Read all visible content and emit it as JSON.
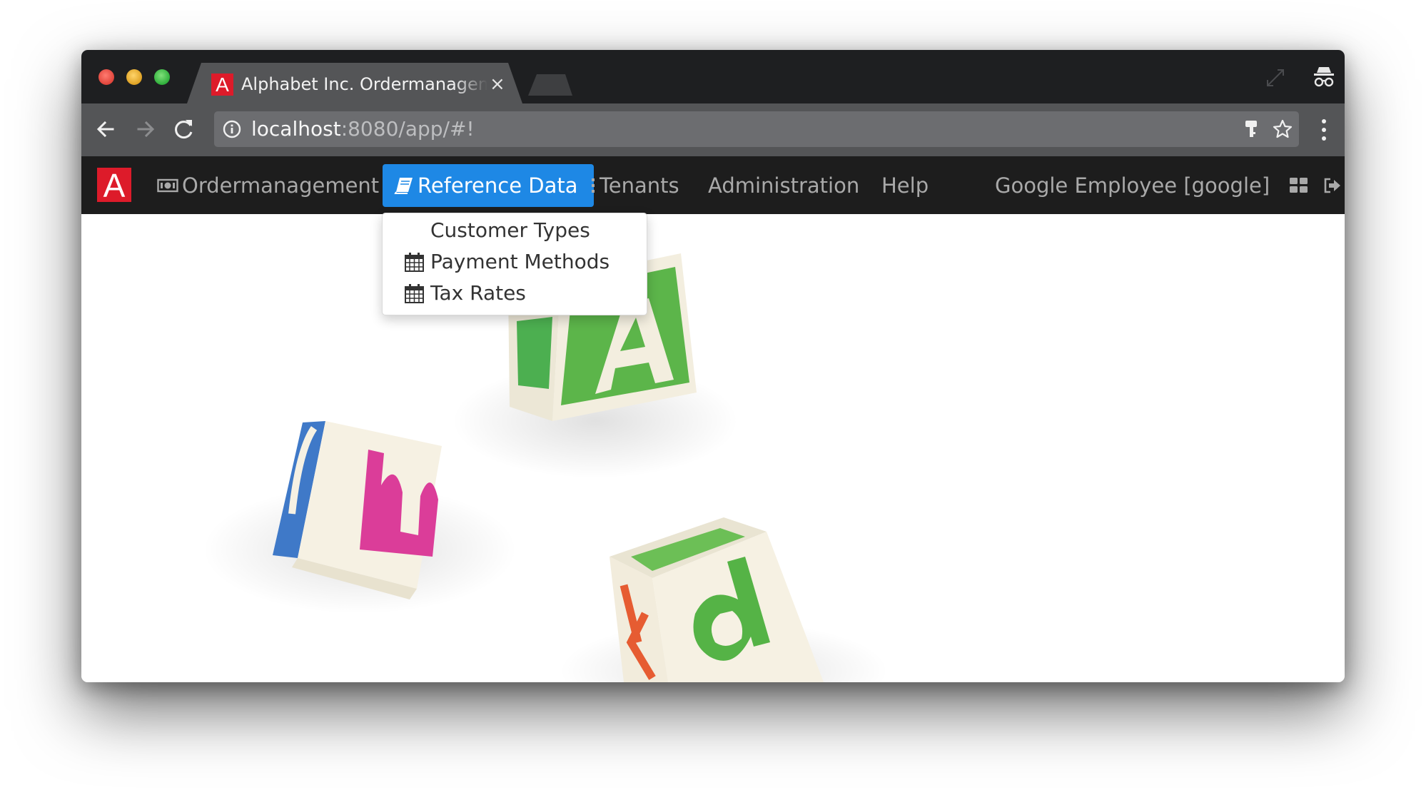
{
  "browser": {
    "tab_title": "Alphabet Inc. Ordermanagement",
    "tab_close_icon": "×",
    "url_host": "localhost",
    "url_rest": ":8080/app/#!",
    "icons": [
      "back-arrow-icon",
      "forward-arrow-icon",
      "reload-icon",
      "info-icon",
      "key-icon",
      "star-icon",
      "menu-icon",
      "incognito-icon",
      "sync-icon"
    ]
  },
  "app": {
    "brand_letter": "A",
    "brand_color": "#dd1b2a",
    "accent_color": "#1e88e5",
    "nav": {
      "ordermanagement": "Ordermanagement",
      "reference_data": "Reference Data",
      "tenants": "Tenants",
      "administration": "Administration",
      "help": "Help",
      "user": "Google Employee [google]"
    },
    "reference_menu": [
      {
        "label": "Customer Types",
        "icon": null
      },
      {
        "label": "Payment Methods",
        "icon": "calendar-icon"
      },
      {
        "label": "Tax Rates",
        "icon": "calendar-icon"
      }
    ],
    "hero_blocks": [
      {
        "letter": "A",
        "color": "#4caf50"
      },
      {
        "letter": "m",
        "color": "#d63b9e"
      },
      {
        "letter": "d",
        "color": "#4caf50"
      },
      {
        "letter": "k",
        "color": "#e65c32"
      }
    ]
  }
}
